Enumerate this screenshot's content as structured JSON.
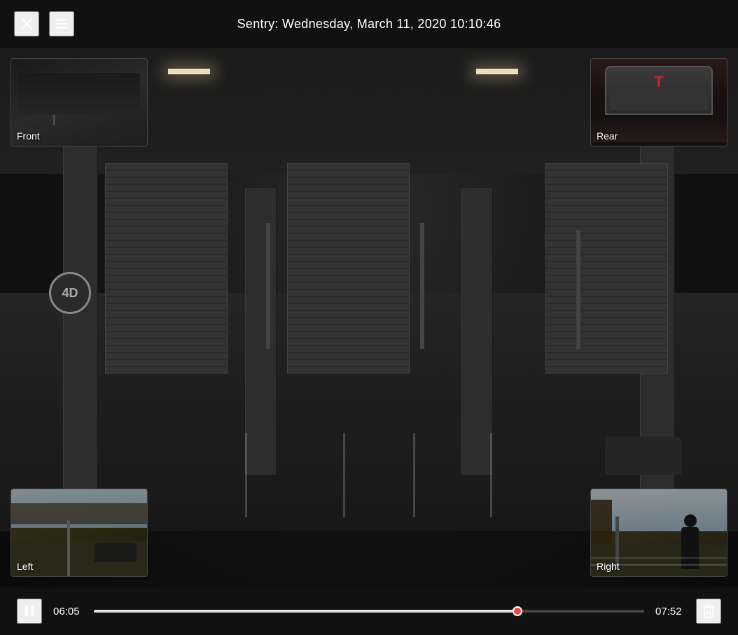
{
  "header": {
    "title": "Sentry: Wednesday, March 11, 2020 10:10:46"
  },
  "controls": {
    "time_current": "06:05",
    "time_total": "07:52",
    "progress_percent": 77,
    "play_pause_label": "pause"
  },
  "cameras": {
    "front": {
      "label": "Front",
      "position": "top-left"
    },
    "rear": {
      "label": "Rear",
      "position": "top-right"
    },
    "left": {
      "label": "Left",
      "position": "bottom-left"
    },
    "right": {
      "label": "Right",
      "position": "bottom-right"
    }
  },
  "icons": {
    "close": "✕",
    "menu": "≡",
    "pause": "⏸",
    "delete": "🗑"
  }
}
